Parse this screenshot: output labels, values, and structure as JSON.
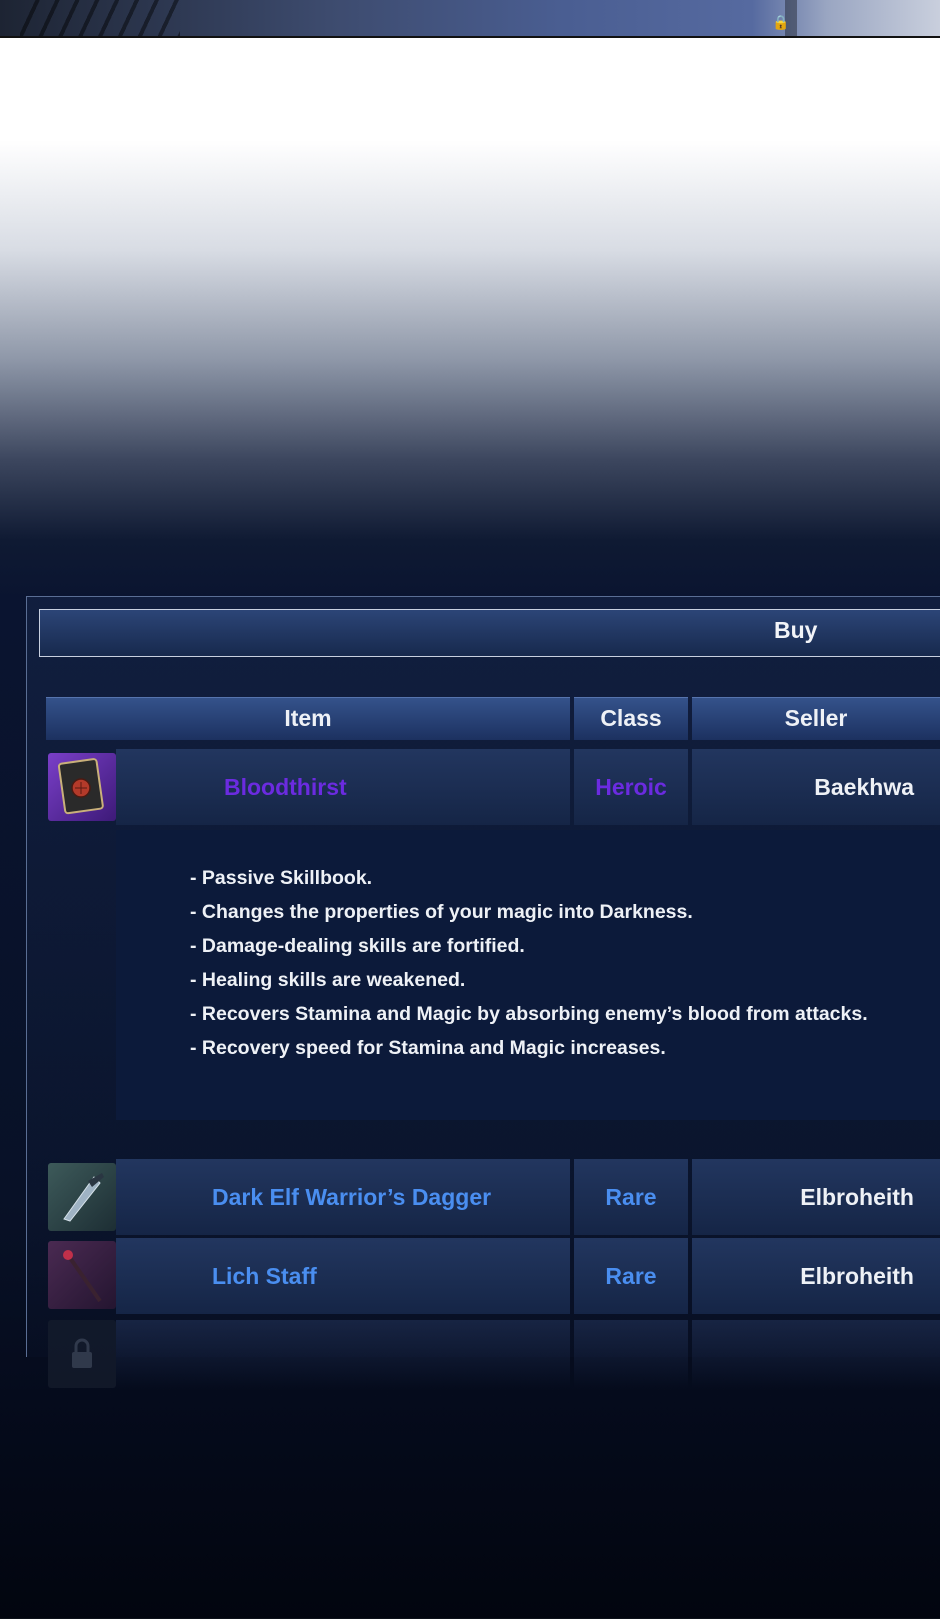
{
  "header": {
    "buy_label": "Buy"
  },
  "table": {
    "columns": [
      "Item",
      "Class",
      "Seller"
    ],
    "rows": [
      {
        "icon": "skillbook-icon",
        "item": "Bloodthirst",
        "class": "Heroic",
        "seller": "Baekhwa",
        "class_color": "#6b2be0",
        "description": [
          "- Passive Skillbook.",
          "- Changes the properties of your magic into Darkness.",
          "- Damage-dealing skills are fortified.",
          "- Healing skills are weakened.",
          "- Recovers Stamina and Magic by absorbing enemy’s blood from attacks.",
          "- Recovery speed for Stamina and Magic increases."
        ]
      },
      {
        "icon": "dagger-icon",
        "item": "Dark Elf Warrior’s Dagger",
        "class": "Rare",
        "seller": "Elbroheith",
        "class_color": "#4a8ef0"
      },
      {
        "icon": "staff-icon",
        "item": "Lich Staff",
        "class": "Rare",
        "seller": "Elbroheith",
        "class_color": "#4a8ef0"
      },
      {
        "icon": "lock-icon",
        "item": "",
        "class": "",
        "seller": ""
      }
    ]
  }
}
